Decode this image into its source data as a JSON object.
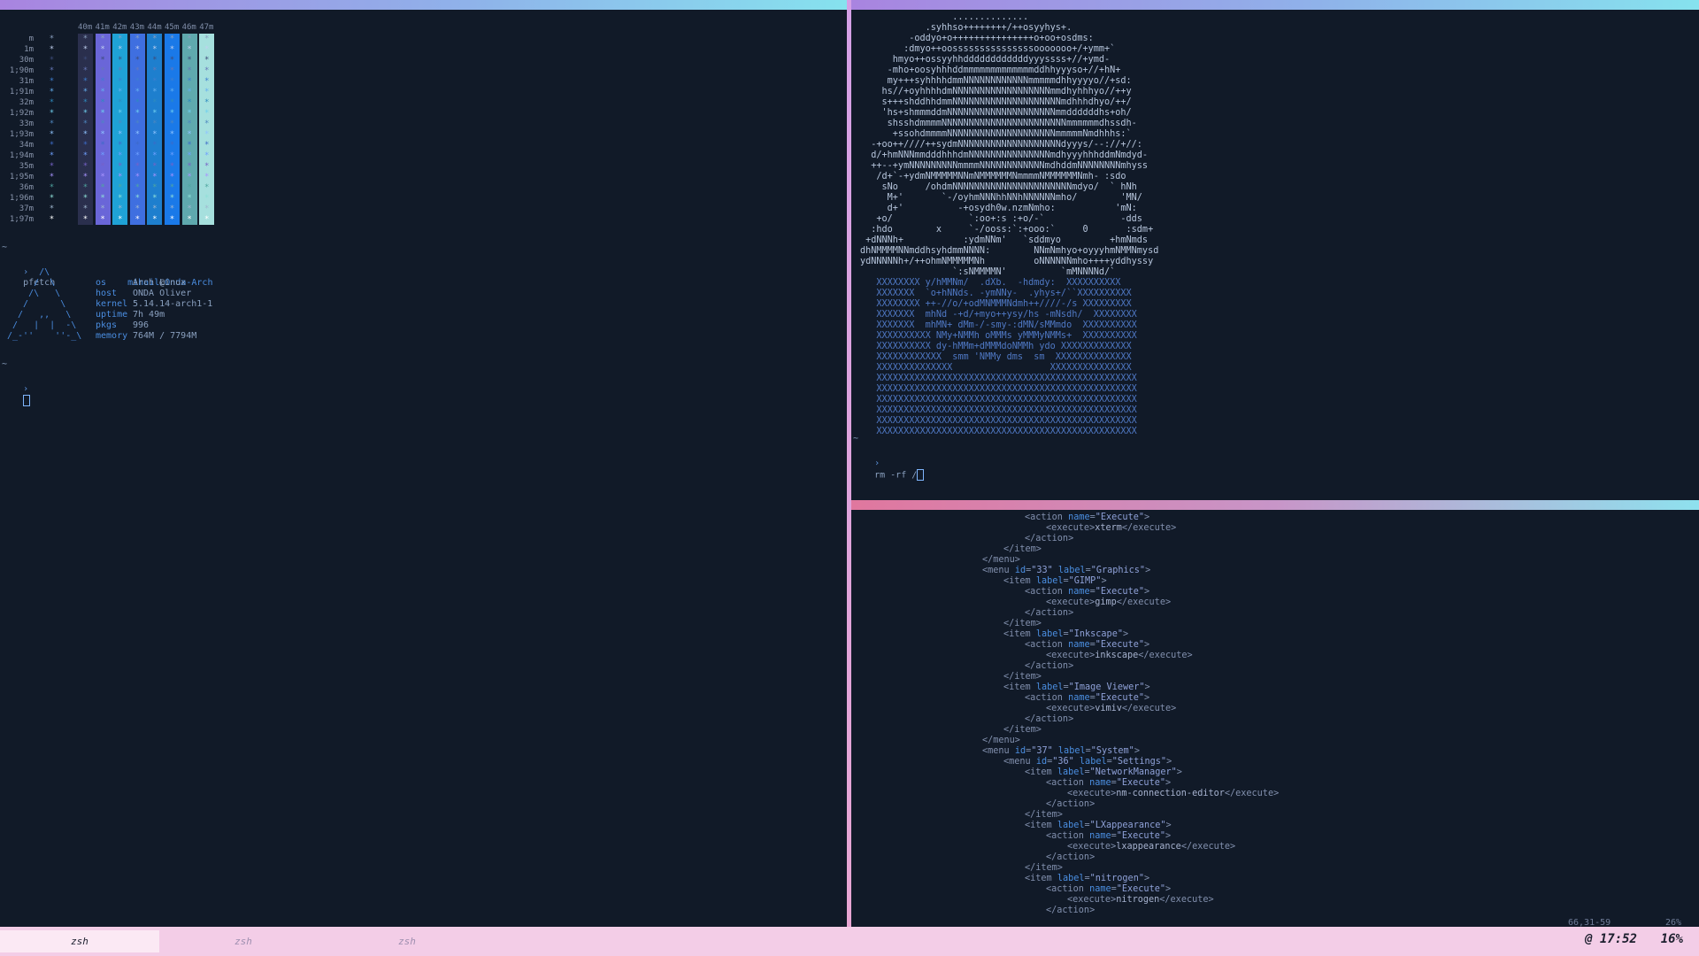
{
  "colortest": {
    "headers": [
      "40m",
      "41m",
      "42m",
      "43m",
      "44m",
      "45m",
      "46m",
      "47m"
    ],
    "rows": [
      "m",
      "1m",
      "30m",
      "1;90m",
      "31m",
      "1;91m",
      "32m",
      "1;92m",
      "33m",
      "1;93m",
      "34m",
      "1;94m",
      "35m",
      "1;95m",
      "36m",
      "1;96m",
      "37m",
      "1;97m"
    ],
    "cell_glyph": "*"
  },
  "left_term": {
    "tilde": "~",
    "prompt_symbol": "›",
    "command": "pfetch",
    "pfetch": {
      "user": "mihail",
      "at": "@",
      "host_name": "Onda-Arch",
      "os_label": "os",
      "os_value": "Arch Linux",
      "host_label": "host",
      "host_value": "ONDA Oliver",
      "kernel_label": "kernel",
      "kernel_value": "5.14.14-arch1-1",
      "uptime_label": "uptime",
      "uptime_value": "7h 49m",
      "pkgs_label": "pkgs",
      "pkgs_value": "996",
      "memory_label": "memory",
      "memory_value": "764M / 7794M",
      "logo_lines": [
        "      /\\",
        "     /  \\",
        "    /\\   \\",
        "   /      \\",
        "  /   ,,   \\",
        " /   |  |  -\\",
        "/_-''    ''-_\\"
      ]
    }
  },
  "right_top": {
    "tilde": "~",
    "prompt_symbol": "›",
    "command": "rm -rf /",
    "art_lines": [
      "                 ..............",
      "            .syhhso++++++++/++osyyhys+.",
      "         -oddyo+o+++++++++++++++o+oo+osdms:",
      "        :dmyo++oosssssssssssssssooooooo+/+ymm+`",
      "      hmyo++ossyyhhddddddddddddyyyssss+//+ymd-",
      "     -mho+oosyhhhddmmmmmmmmmmmmmddhhyyyso+//+hN+",
      "     my+++syhhhhdmmNNNNNNNNNNNNmmmmmdhhyyyyo//+sd:",
      "    hs//+oyhhhhdmNNNNNNNNNNNNNNNNNNmmdhyhhhyo//++y",
      "    s+++shddhhdmmNNNNNNNNNNNNNNNNNNNNmdhhhdhyo/++/",
      "    'hs+shmmmddmNNNNNNNNNNNNNNNNNNNNmmddddddhs+oh/",
      "     shsshdmmmmNNNNNNNNNNNNNNNNNNNNNNNmmmmmmdhssdh-",
      "      +ssohdmmmmNNNNNNNNNNNNNNNNNNNNmmmmmNmdhhhs:`",
      "  -+oo++////++sydmNNNNNNNNNNNNNNNNNNNdyyys/--://+//:",
      "  d/+hmNNNmmdddhhhdmNNNNNNNNNNNNNNNmdhyyyhhhddmNmdyd-",
      "  ++--+ymNNNNNNNNNmmmmNNNNNNNNNNNNmdhddmNNNNNNNNmhyss",
      "   /d+`-+ydmNMMMMMNNmNMMMMMMNmmmmNMMMMMMNmh- :sdo",
      "    sNo     /ohdmNNNNNNNNNNNNNNNNNNNNNNmdyo/  ` hNh",
      "     M+'       `-/oyhmNNNhhNNhNNNNNNmho/        'MN/",
      "     d+'          -+osydh0w.nzmNmho:           'mN:",
      "   +o/              `:oo+:s :+o/-`              -dds",
      "  :hdo        x     `-/ooss:`:+ooo:`     0       :sdm+",
      " +dNNNh+           :ydmNNm'   `sddmyo         +hmNmds",
      "dhNMMMMNNmddhsyhdmmNNNN:        NNmNmhyo+oyyyhmNMMNmysd",
      "ydNNNNNh+/++ohmNMMMMMNh         oNNNNNNmho++++yddhyssy",
      "                 `:sNMMMMN'          `mMNNNNd/`",
      "   XXXXXXXX y/hMMNm/  .dXb.  -hdmdy:  XXXXXXXXXX",
      "   XXXXXXX  `o+hNNds. -ymNNy-  .yhys+/``XXXXXXXXXX",
      "   XXXXXXXX ++-//o/+odMNMMMNdmh++////-/s XXXXXXXXX",
      "   XXXXXXX  mhNd -+d/+myo++ysy/hs -mNsdh/  XXXXXXXX",
      "   XXXXXXX  mhMN+ dMm-/-smy-:dMN/sMMmdo  XXXXXXXXXX",
      "   XXXXXXXXXX NMy+NMMh oMMMs yMMMyNMMs+  XXXXXXXXXX",
      "   XXXXXXXXXX dy-hMMm+dMMMdoNMMh ydo XXXXXXXXXXXXX",
      "   XXXXXXXXXXXX  smm 'NMMy dms  sm  XXXXXXXXXXXXXX",
      "   XXXXXXXXXXXXXX                  XXXXXXXXXXXXXXX",
      "   XXXXXXXXXXXXXXXXXXXXXXXXXXXXXXXXXXXXXXXXXXXXXXXX",
      "   XXXXXXXXXXXXXXXXXXXXXXXXXXXXXXXXXXXXXXXXXXXXXXXX",
      "   XXXXXXXXXXXXXXXXXXXXXXXXXXXXXXXXXXXXXXXXXXXXXXXX",
      "   XXXXXXXXXXXXXXXXXXXXXXXXXXXXXXXXXXXXXXXXXXXXXXXX",
      "   XXXXXXXXXXXXXXXXXXXXXXXXXXXXXXXXXXXXXXXXXXXXXXXX",
      "   XXXXXXXXXXXXXXXXXXXXXXXXXXXXXXXXXXXXXXXXXXXXXXXX"
    ]
  },
  "editor": {
    "lines": [
      {
        "indent": 16,
        "t": "<action name=\"Execute\">"
      },
      {
        "indent": 20,
        "t": "<execute>xterm</execute>"
      },
      {
        "indent": 16,
        "t": "</action>"
      },
      {
        "indent": 12,
        "t": "</item>"
      },
      {
        "indent": 8,
        "t": "</menu>"
      },
      {
        "indent": 8,
        "t": "<menu id=\"33\" label=\"Graphics\">"
      },
      {
        "indent": 12,
        "t": "<item label=\"GIMP\">"
      },
      {
        "indent": 16,
        "t": "<action name=\"Execute\">"
      },
      {
        "indent": 20,
        "t": "<execute>gimp</execute>"
      },
      {
        "indent": 16,
        "t": "</action>"
      },
      {
        "indent": 12,
        "t": "</item>"
      },
      {
        "indent": 12,
        "t": "<item label=\"Inkscape\">"
      },
      {
        "indent": 16,
        "t": "<action name=\"Execute\">"
      },
      {
        "indent": 20,
        "t": "<execute>inkscape</execute>"
      },
      {
        "indent": 16,
        "t": "</action>"
      },
      {
        "indent": 12,
        "t": "</item>"
      },
      {
        "indent": 12,
        "t": "<item label=\"Image Viewer\">"
      },
      {
        "indent": 16,
        "t": "<action name=\"Execute\">"
      },
      {
        "indent": 20,
        "t": "<execute>vimiv</execute>"
      },
      {
        "indent": 16,
        "t": "</action>"
      },
      {
        "indent": 12,
        "t": "</item>"
      },
      {
        "indent": 8,
        "t": "</menu>"
      },
      {
        "indent": 8,
        "t": "<menu id=\"37\" label=\"System\">"
      },
      {
        "indent": 12,
        "t": "<menu id=\"36\" label=\"Settings\">"
      },
      {
        "indent": 16,
        "t": "<item label=\"NetworkManager\">"
      },
      {
        "indent": 20,
        "t": "<action name=\"Execute\">"
      },
      {
        "indent": 24,
        "t": "<execute>nm-connection-editor</execute>"
      },
      {
        "indent": 20,
        "t": "</action>"
      },
      {
        "indent": 16,
        "t": "</item>"
      },
      {
        "indent": 16,
        "t": "<item label=\"LXappearance\">"
      },
      {
        "indent": 20,
        "t": "<action name=\"Execute\">"
      },
      {
        "indent": 24,
        "t": "<execute>lxappearance</execute>"
      },
      {
        "indent": 20,
        "t": "</action>"
      },
      {
        "indent": 16,
        "t": "</item>"
      },
      {
        "indent": 16,
        "t": "<item label=\"nitrogen\">"
      },
      {
        "indent": 20,
        "t": "<action name=\"Execute\">"
      },
      {
        "indent": 24,
        "t": "<execute>nitrogen</execute>"
      },
      {
        "indent": 20,
        "t": "</action>"
      }
    ],
    "cursor_position": "66,31-59",
    "scroll_percent": "26%"
  },
  "statusbar": {
    "tabs": [
      "zsh",
      "zsh",
      "zsh"
    ],
    "active_tab_index": 0,
    "clock": "@ 17:52",
    "percent": "16%"
  },
  "colors": {
    "bg": "#111a28",
    "accent_blue": "#4a8de0",
    "status_bg": "#f3cde7",
    "columns": [
      "#2a2f4d",
      "#6a66d8",
      "#1fa2d6",
      "#3f6fe0",
      "#1e7fce",
      "#1a79e8",
      "#5fa9ae",
      "#a6e0de"
    ]
  }
}
